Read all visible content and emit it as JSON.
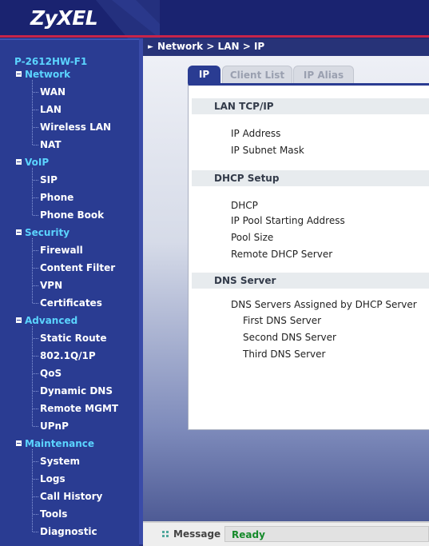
{
  "header": {
    "logo": "ZyXEL"
  },
  "breadcrumb": "Network > LAN > IP",
  "sidebar": {
    "device": "P-2612HW-F1",
    "categories": [
      {
        "label": "Network",
        "items": [
          "WAN",
          "LAN",
          "Wireless LAN",
          "NAT"
        ]
      },
      {
        "label": "VoIP",
        "items": [
          "SIP",
          "Phone",
          "Phone Book"
        ]
      },
      {
        "label": "Security",
        "items": [
          "Firewall",
          "Content Filter",
          "VPN",
          "Certificates"
        ]
      },
      {
        "label": "Advanced",
        "items": [
          "Static Route",
          "802.1Q/1P",
          "QoS",
          "Dynamic DNS",
          "Remote MGMT",
          "UPnP"
        ]
      },
      {
        "label": "Maintenance",
        "items": [
          "System",
          "Logs",
          "Call History",
          "Tools",
          "Diagnostic"
        ]
      }
    ]
  },
  "tabs": [
    {
      "label": "IP",
      "active": true
    },
    {
      "label": "Client List",
      "active": false
    },
    {
      "label": "IP Alias",
      "active": false
    }
  ],
  "sections": {
    "lan": {
      "title": "LAN TCP/IP",
      "fields": [
        "IP Address",
        "IP Subnet Mask"
      ]
    },
    "dhcp": {
      "title": "DHCP Setup",
      "fields": [
        "DHCP",
        "IP Pool Starting Address",
        "Pool Size",
        "Remote DHCP Server"
      ]
    },
    "dns": {
      "title": "DNS Server",
      "assigned_label": "DNS Servers Assigned by DHCP Server",
      "fields": [
        "First DNS Server",
        "Second DNS Server",
        "Third DNS Server"
      ]
    }
  },
  "statusbar": {
    "label": "Message",
    "status": "Ready"
  },
  "colors": {
    "nav_category": "#5bd4ff",
    "nav_item": "#ffffff",
    "status_ok": "#158a2a",
    "accent": "#2a3c92"
  }
}
